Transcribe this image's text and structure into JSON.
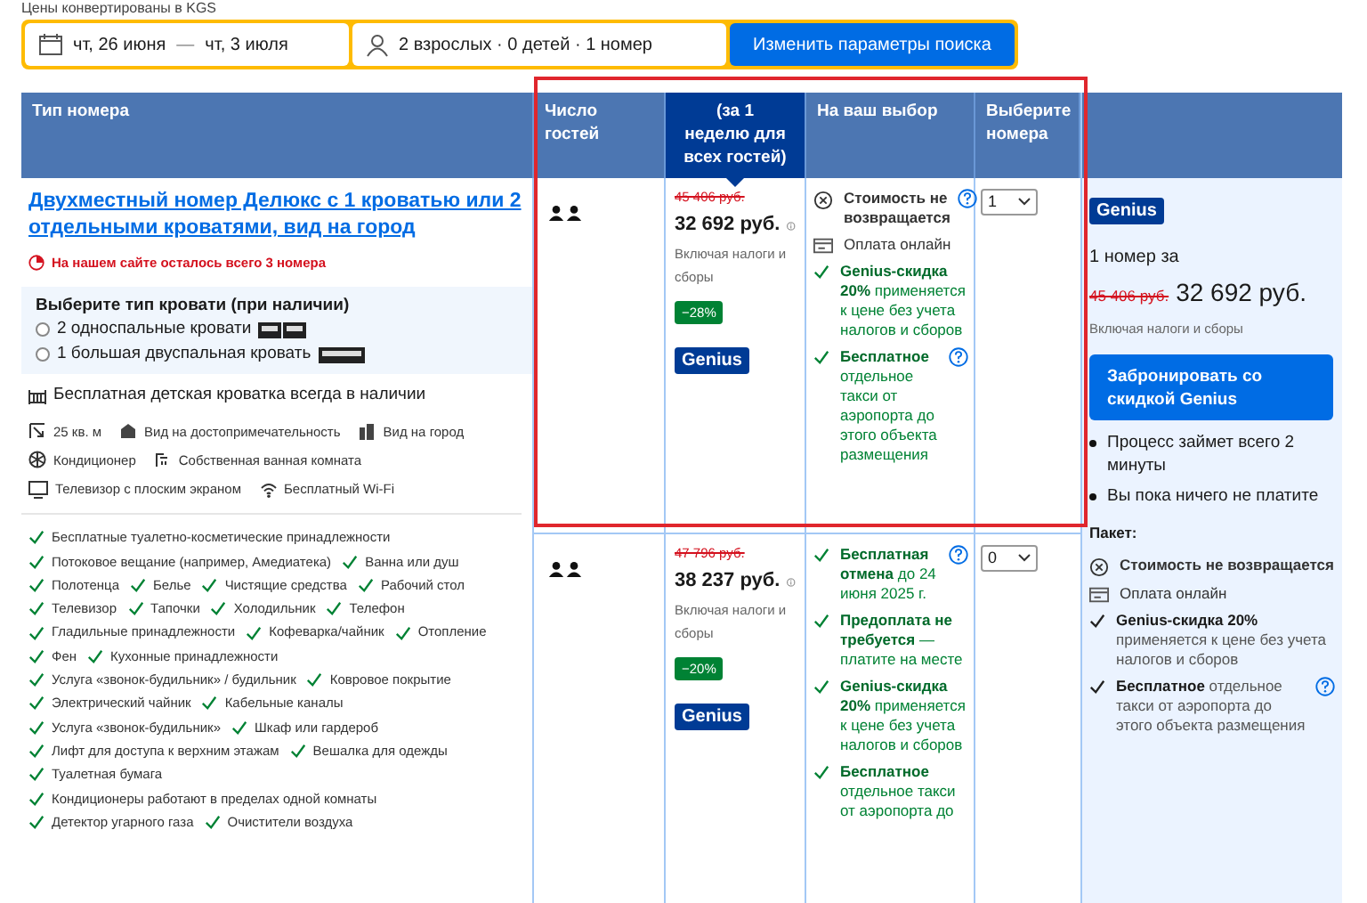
{
  "notice": "Цены конвертированы в KGS",
  "search": {
    "dates": {
      "checkin": "чт, 26 июня",
      "separator": "—",
      "checkout": "чт, 3 июля"
    },
    "guests": "2 взрослых · 0 детей · 1 номер",
    "button": "Изменить параметры поиска"
  },
  "table": {
    "columns": [
      {
        "label": "Тип номера",
        "highlighted": false
      },
      {
        "label": "Число гостей",
        "highlighted": false
      },
      {
        "label": "(за 1 неделю для всех гостей)",
        "highlighted": true
      },
      {
        "label": "На ваш выбор",
        "highlighted": false
      },
      {
        "label": "Выберите номера",
        "highlighted": false
      }
    ],
    "room": {
      "name": "Двухместный номер Делюкс с 1 кроватью или 2 отдельными кроватями, вид на город",
      "scarcity": "На нашем сайте осталось всего 3 номера",
      "bed_choice": {
        "title": "Выберите тип кровати (при наличии)",
        "options": [
          {
            "label": "2 односпальные кровати",
            "kind": "twin",
            "selected": false
          },
          {
            "label": "1 большая двуспальная кровать",
            "kind": "double",
            "selected": false
          }
        ]
      },
      "crib": "Бесплатная детская кроватка всегда в наличии",
      "facilities": [
        [
          {
            "kind": "size",
            "label": "25 кв. м"
          },
          {
            "kind": "landmark",
            "label": "Вид на достопримечательность"
          },
          {
            "kind": "city",
            "label": "Вид на город"
          }
        ],
        [
          {
            "kind": "ac",
            "label": "Кондиционер"
          },
          {
            "kind": "bath",
            "label": "Собственная ванная комната"
          }
        ],
        [
          {
            "kind": "tv",
            "label": "Телевизор с плоским экраном"
          },
          {
            "kind": "wifi",
            "label": "Бесплатный Wi-Fi"
          }
        ]
      ],
      "amenities": [
        [
          "Бесплатные туалетно-косметические принадлежности"
        ],
        [
          "Потоковое вещание (например, Амедиатека)",
          "Ванна или душ"
        ],
        [
          "Полотенца",
          "Белье",
          "Чистящие средства",
          "Рабочий стол"
        ],
        [
          "Телевизор",
          "Тапочки",
          "Холодильник",
          "Телефон"
        ],
        [
          "Гладильные принадлежности",
          "Кофеварка/чайник",
          "Отопление"
        ],
        [
          "Фен",
          "Кухонные принадлежности"
        ],
        [
          "Услуга «звонок-будильник» / будильник",
          "Ковровое покрытие"
        ],
        [
          "Электрический чайник",
          "Кабельные каналы"
        ],
        [
          "Услуга «звонок-будильник»",
          "Шкаф или гардероб"
        ],
        [
          "Лифт для доступа к верхним этажам",
          "Вешалка для одежды"
        ],
        [
          "Туалетная бумага"
        ],
        [
          "Кондиционеры работают в пределах одной комнаты"
        ],
        [
          "Детектор угарного газа",
          "Очистители воздуха"
        ]
      ]
    },
    "offers": [
      {
        "old_price": "45 406 руб.",
        "price": "32 692 руб.",
        "taxes": "Включая налоги и сборы",
        "discount": "−28%",
        "badge": "Genius",
        "quantity": "1",
        "conditions": [
          {
            "kind": "nonrefundable",
            "text": "**Стоимость не возвращается**",
            "help": true
          },
          {
            "kind": "online",
            "text": "Оплата онлайн",
            "help": false
          },
          {
            "kind": "check",
            "text": "**Genius-скидка 20%** применяется к цене без учета налогов и сборов",
            "help": false
          },
          {
            "kind": "check",
            "text": "**Бесплатное** отдельное такси от аэропорта до этого объекта размещения",
            "help": true
          }
        ]
      },
      {
        "old_price": "47 796 руб.",
        "price": "38 237 руб.",
        "taxes": "Включая налоги и сборы",
        "discount": "−20%",
        "badge": "Genius",
        "quantity": "0",
        "conditions": [
          {
            "kind": "check",
            "text": "**Бесплатная отмена** до 24 июня 2025 г.",
            "help": true
          },
          {
            "kind": "check",
            "text": "**Предоплата не требуется** — платите на месте",
            "help": false
          },
          {
            "kind": "check",
            "text": "**Genius-скидка 20%** применяется к цене без учета налогов и сборов",
            "help": false
          },
          {
            "kind": "check",
            "text": "**Бесплатное** отдельное такси от аэропорта до",
            "help": false
          }
        ]
      }
    ]
  },
  "summary": {
    "badge": "Genius",
    "count": "1 номер за",
    "old_price": "45 406 руб.",
    "price": "32 692 руб.",
    "taxes": "Включая налоги и сборы",
    "button": "Забронировать со скидкой Genius",
    "bullets": [
      "Процесс займет всего 2 минуты",
      "Вы пока ничего не платите"
    ],
    "package_title": "Пакет:",
    "package": [
      {
        "kind": "nonrefundable",
        "text": "**Стоимость не возвращается**",
        "help": false
      },
      {
        "kind": "online",
        "text": "Оплата онлайн",
        "help": false
      },
      {
        "kind": "check",
        "text": "**Genius-скидка 20%** применяется к цене без учета налогов и сборов",
        "help": false
      },
      {
        "kind": "check",
        "text": "**Бесплатное** отдельное такси от аэропорта до этого объекта размещения",
        "help": true
      }
    ]
  }
}
